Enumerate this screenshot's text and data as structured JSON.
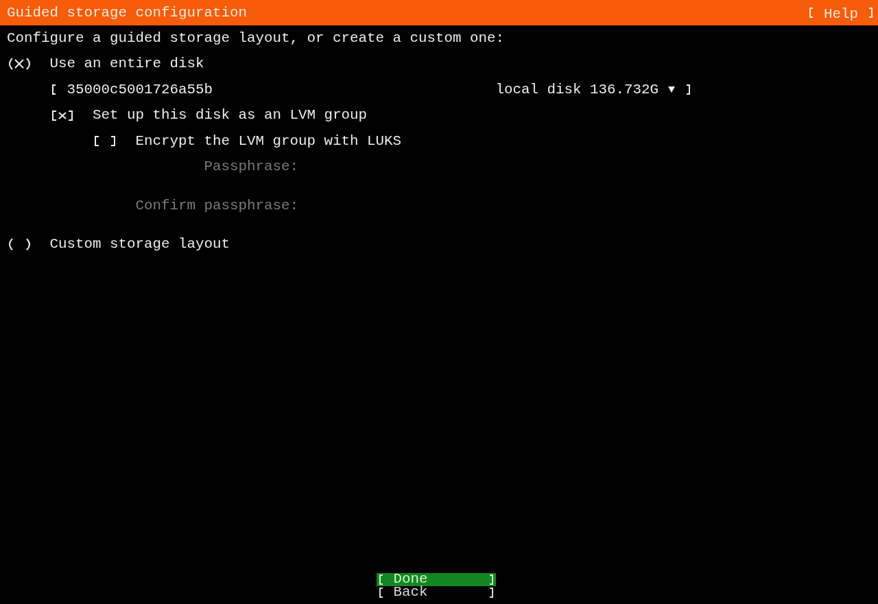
{
  "header": {
    "title": "Guided storage configuration",
    "help": "Help"
  },
  "intro": "Configure a guided storage layout, or create a custom one:",
  "options": [
    {
      "kind": "radio",
      "label": "Use an entire disk",
      "selected": true,
      "children": [
        {
          "kind": "select",
          "value": "35000c5001726a55b",
          "detail": "local disk 136.732G"
        },
        {
          "kind": "checkbox",
          "label": "Set up this disk as an LVM group",
          "checked": true,
          "children": [
            {
              "kind": "checkbox",
              "label": "Encrypt the LVM group with LUKS",
              "checked": false,
              "children": [
                {
                  "kind": "password",
                  "label": "Passphrase:",
                  "disabled": true
                },
                {
                  "kind": "password",
                  "label": "Confirm passphrase:",
                  "disabled": true
                }
              ]
            }
          ]
        }
      ]
    },
    {
      "kind": "radio",
      "label": "Custom storage layout",
      "selected": false
    }
  ],
  "buttons": [
    {
      "label": "Done",
      "selected": true
    },
    {
      "label": "Back",
      "selected": false
    }
  ]
}
